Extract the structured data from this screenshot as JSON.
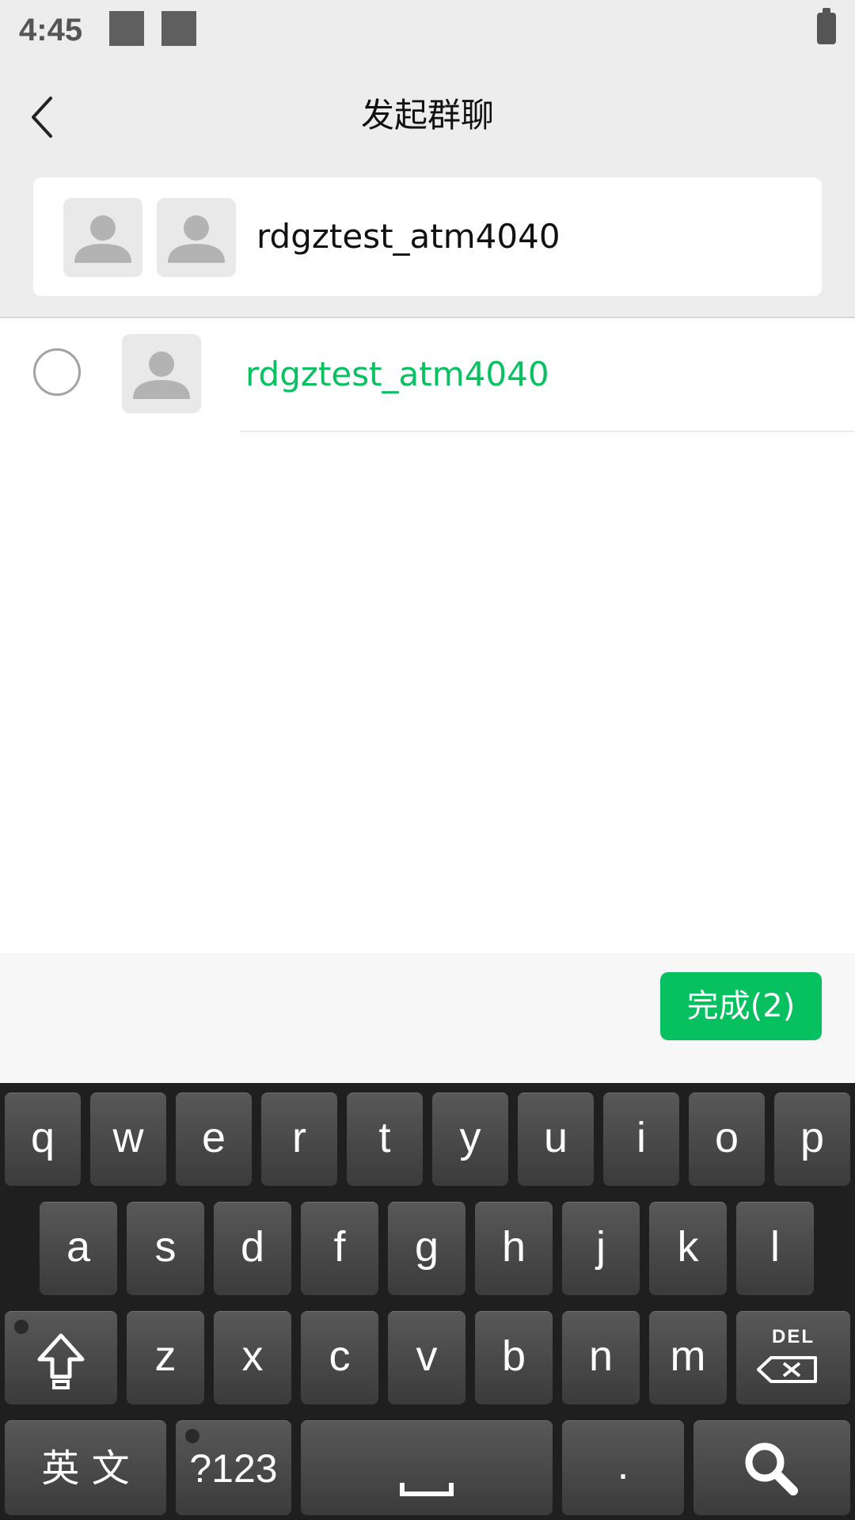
{
  "status_bar": {
    "time": "4:45"
  },
  "header": {
    "title": "发起群聊"
  },
  "search": {
    "query": "rdgztest_atm4040"
  },
  "contacts": [
    {
      "name": "rdgztest_atm4040",
      "selected": false
    }
  ],
  "footer": {
    "done_label": "完成(2)"
  },
  "keyboard": {
    "row1": [
      "q",
      "w",
      "e",
      "r",
      "t",
      "y",
      "u",
      "i",
      "o",
      "p"
    ],
    "row2": [
      "a",
      "s",
      "d",
      "f",
      "g",
      "h",
      "j",
      "k",
      "l"
    ],
    "row3": [
      "z",
      "x",
      "c",
      "v",
      "b",
      "n",
      "m"
    ],
    "lang_label": "英 文",
    "sym_label": "?123",
    "period_label": ".",
    "del_label": "DEL"
  },
  "colors": {
    "accent": "#07c160",
    "header_bg": "#ededed",
    "keyboard_bg": "#1f1f1f"
  }
}
